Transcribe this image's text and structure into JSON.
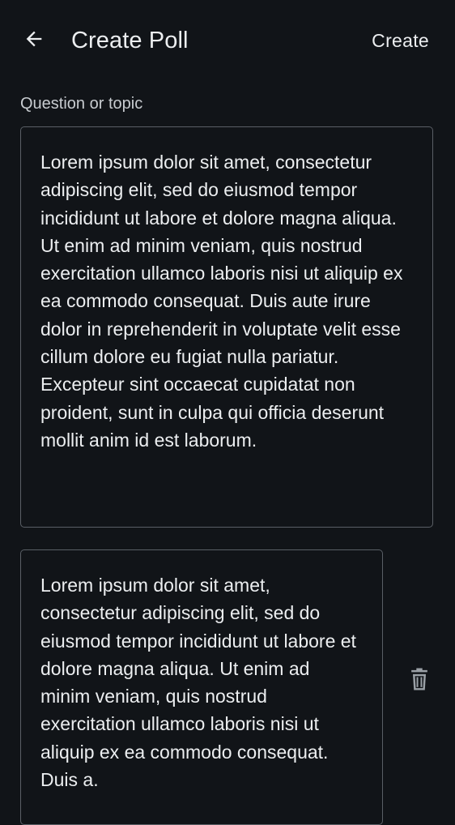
{
  "header": {
    "back_icon": "arrow-left-icon",
    "title": "Create Poll",
    "action_label": "Create"
  },
  "question": {
    "label": "Question or topic",
    "value": "Lorem ipsum dolor sit amet, consectetur adipiscing elit, sed do eiusmod tempor incididunt ut labore et dolore magna aliqua. Ut enim ad minim veniam, quis nostrud exercitation ullamco laboris nisi ut aliquip ex ea commodo consequat. Duis aute irure dolor in reprehenderit in voluptate velit esse cillum dolore eu fugiat nulla pariatur. Excepteur sint occaecat cupidatat non proident, sunt in culpa qui officia deserunt mollit anim id est laborum."
  },
  "options": [
    {
      "value": "Lorem ipsum dolor sit amet, consectetur adipiscing elit, sed do eiusmod tempor incididunt ut labore et dolore magna aliqua. Ut enim ad minim veniam, quis nostrud exercitation ullamco laboris nisi ut aliquip ex ea commodo consequat. Duis a.",
      "delete_icon": "trash-icon"
    }
  ],
  "colors": {
    "background": "#111418",
    "text": "#eceef0",
    "label": "#c8ccd0",
    "border": "#5a5f66",
    "icon": "#9aa0a6"
  }
}
